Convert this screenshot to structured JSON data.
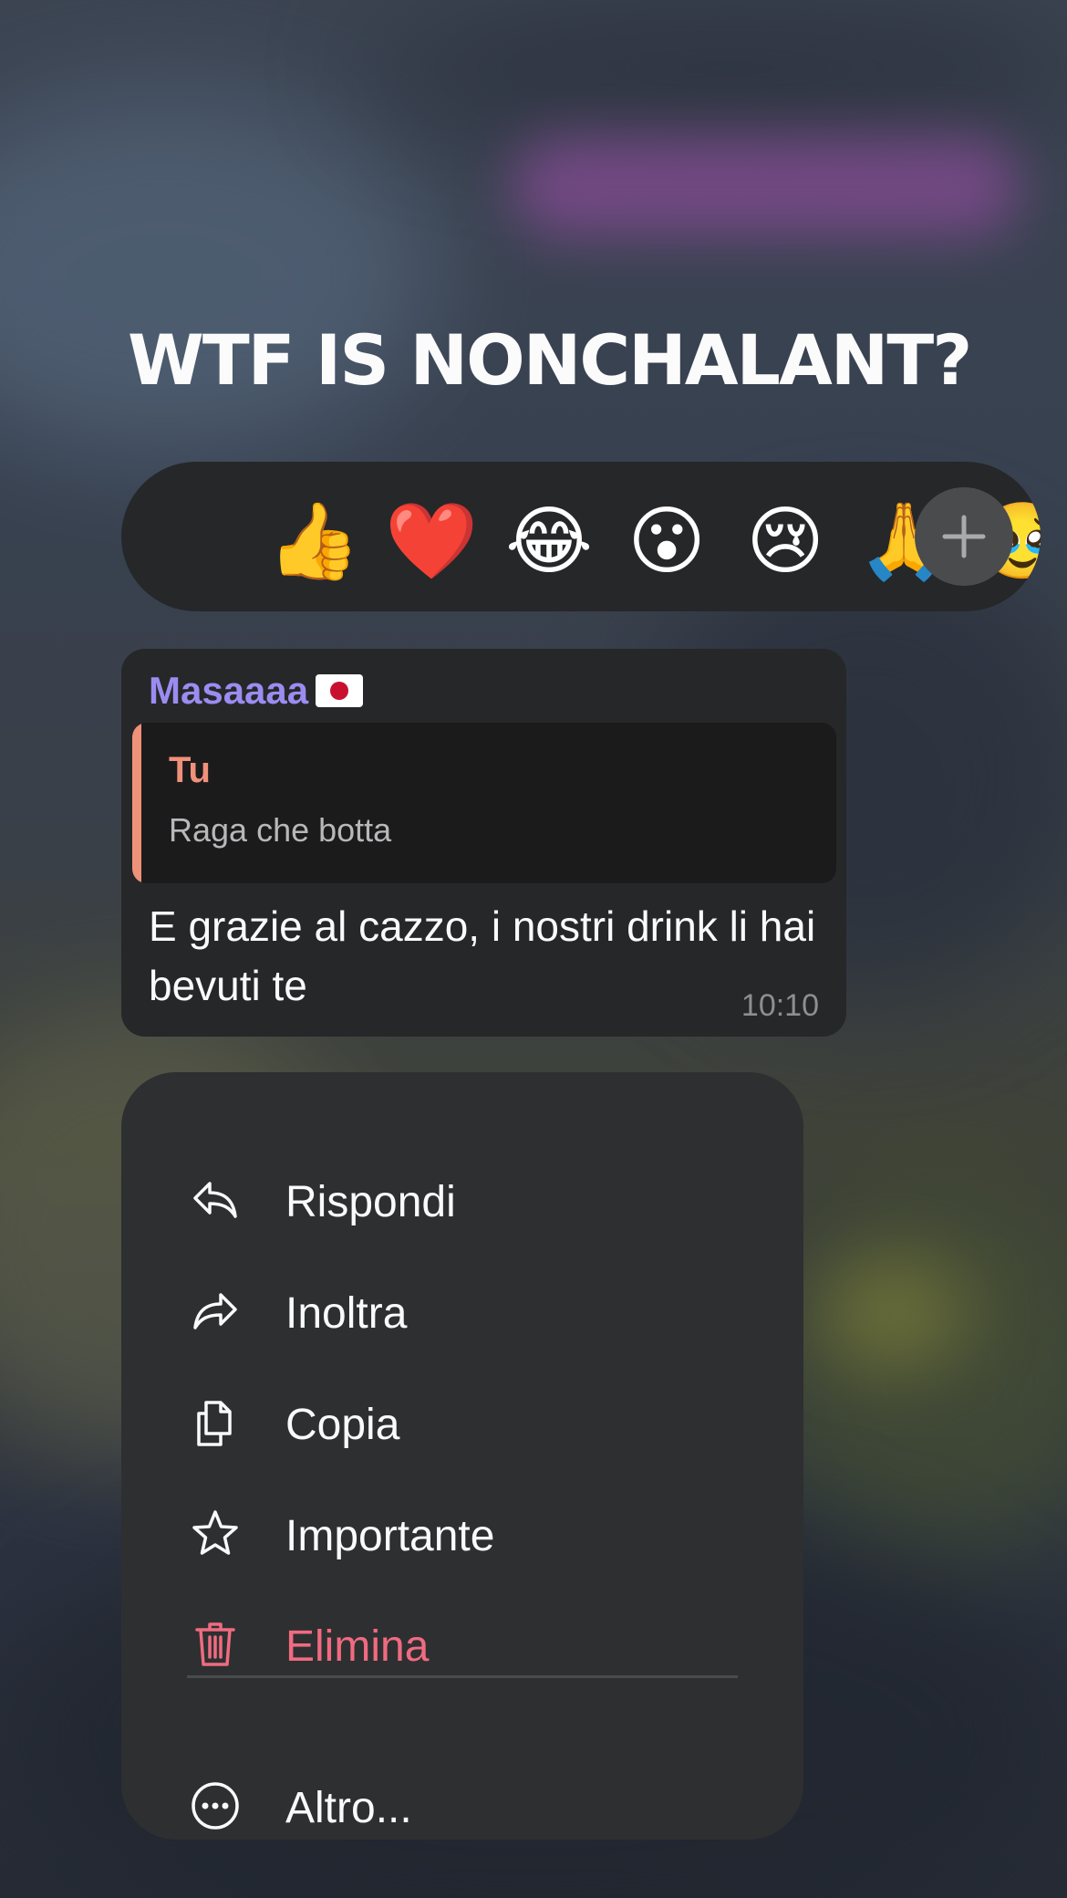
{
  "chat": {
    "title": "WTF IS NONCHALANT?"
  },
  "reactions": {
    "emojis": [
      "👍",
      "❤️",
      "😂",
      "😮",
      "😢",
      "🙏",
      "🥹"
    ],
    "more_icon": "plus-icon"
  },
  "message": {
    "sender": "Masaaaa",
    "sender_flag": "🇯🇵",
    "reply": {
      "author": "Tu",
      "text": "Raga che botta"
    },
    "text": "E grazie al cazzo, i nostri drink li hai bevuti te",
    "time": "10:10"
  },
  "menu": {
    "reply": "Rispondi",
    "forward": "Inoltra",
    "copy": "Copia",
    "important": "Importante",
    "delete": "Elimina",
    "more": "Altro..."
  },
  "colors": {
    "sender": "#9b8cf0",
    "reply_accent": "#f0917a",
    "danger": "#f06b80",
    "surface": "#262729",
    "menu_surface": "#2e2f31"
  }
}
